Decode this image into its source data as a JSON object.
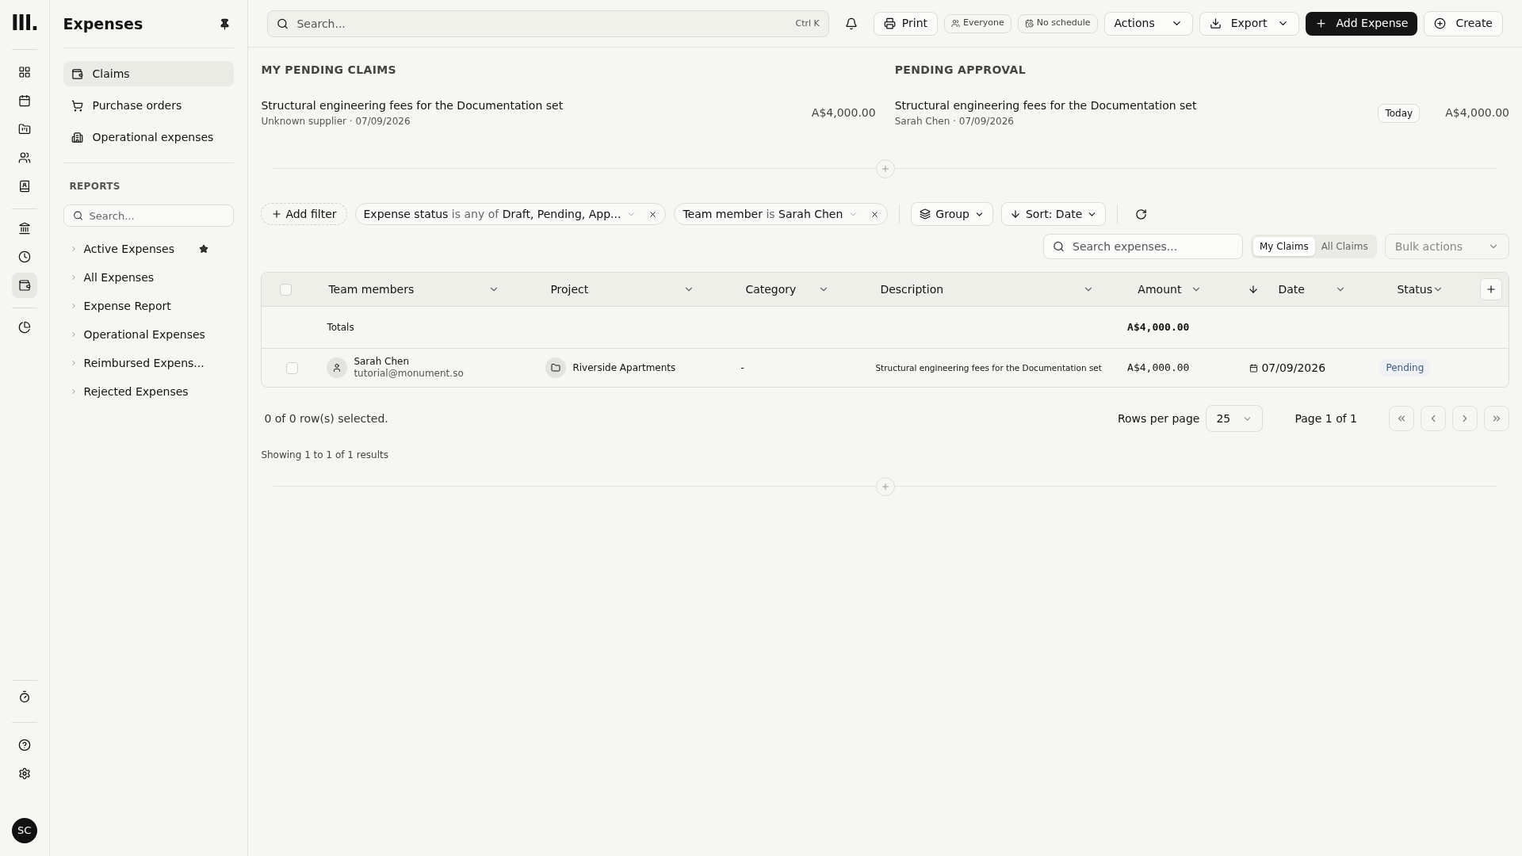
{
  "rail": {
    "logo": "III.",
    "items": [
      {
        "selected": false
      },
      {
        "selected": false
      },
      {
        "selected": false
      },
      {
        "selected": false
      },
      {
        "selected": false
      },
      {
        "selected": false
      },
      {
        "selected": false
      },
      {
        "selected": true
      },
      {
        "selected": false
      }
    ],
    "bottom_avatar": "SC"
  },
  "sidebar": {
    "title": "Expenses",
    "nav": [
      {
        "label": "Claims",
        "selected": true
      },
      {
        "label": "Purchase orders",
        "selected": false
      },
      {
        "label": "Operational expenses",
        "selected": false
      }
    ],
    "reports_heading": "REPORTS",
    "search": {
      "placeholder": "Search..."
    },
    "reports": [
      {
        "label": "Active Expenses",
        "starred": true
      },
      {
        "label": "All Expenses",
        "starred": false
      },
      {
        "label": "Expense Report",
        "starred": false
      },
      {
        "label": "Operational Expenses",
        "starred": false
      },
      {
        "label": "Reimbursed Expens...",
        "starred": false
      },
      {
        "label": "Rejected Expenses",
        "starred": false
      }
    ]
  },
  "topbar": {
    "search": {
      "placeholder": "Search...",
      "shortcut": "Ctrl K"
    },
    "print": "Print",
    "everyone": "Everyone",
    "schedule": "No schedule",
    "actions": "Actions",
    "export": "Export",
    "add": "Add Expense",
    "create": "Create"
  },
  "pending": [
    {
      "heading": "MY PENDING CLAIMS",
      "items": [
        {
          "title": "Structural engineering fees for the Documentation set",
          "meta": "Unknown supplier · 07/09/2026",
          "amount": "A$4,000.00"
        }
      ]
    },
    {
      "heading": "PENDING APPROVAL",
      "items": [
        {
          "title": "Structural engineering fees for the Documentation set",
          "meta": "Sarah Chen · 07/09/2026",
          "badge": "Today",
          "amount": "A$4,000.00"
        }
      ]
    }
  ],
  "filters": {
    "add": "Add filter",
    "chips": [
      {
        "field": "Expense status",
        "op": "is any of",
        "value": "Draft, Pending, App..."
      },
      {
        "field": "Team member",
        "op": "is",
        "value": "Sarah Chen"
      }
    ],
    "group": "Group",
    "sort": "Sort: Date"
  },
  "toolbar": {
    "search": {
      "placeholder": "Search expenses..."
    },
    "toggle": [
      {
        "label": "My Claims",
        "selected": true
      },
      {
        "label": "All Claims",
        "selected": false
      }
    ],
    "bulk": "Bulk actions"
  },
  "table": {
    "select_all": {
      "checked": false
    },
    "columns": [
      "Team members",
      "Project",
      "Category",
      "Description",
      "Amount",
      "Date",
      "Status"
    ],
    "totals_label": "Totals",
    "totals_amount": "A$4,000.00",
    "rows": [
      {
        "checked": false,
        "name": "Sarah Chen",
        "email": "tutorial@monument.so",
        "project": "Riverside Apartments",
        "category": "-",
        "description": "Structural engineering fees for the Documentation set",
        "amount": "A$4,000.00",
        "date": "07/09/2026",
        "status": "Pending"
      }
    ]
  },
  "footer": {
    "selected": "0 of 0 row(s) selected.",
    "rows_per_page": "Rows per page",
    "page_size": "25",
    "page": "Page 1 of 1",
    "showing": "Showing 1 to 1 of 1 results"
  }
}
